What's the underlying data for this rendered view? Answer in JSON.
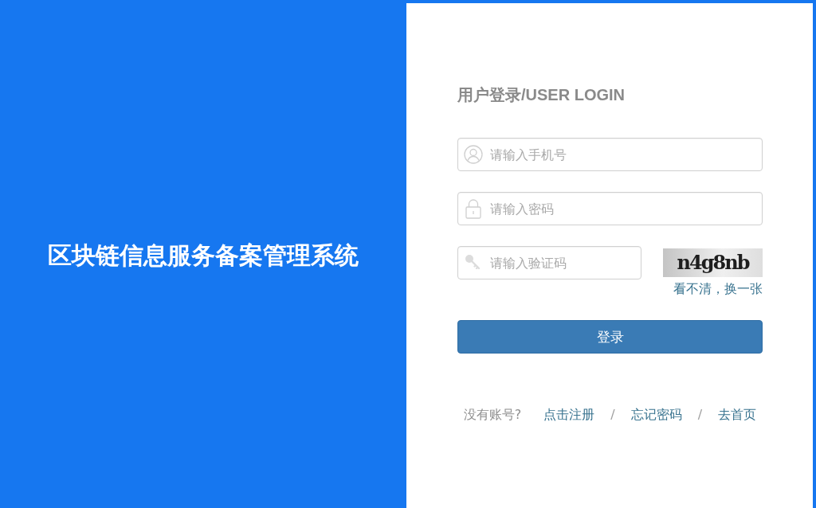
{
  "brand_panel": {
    "title": "区块链信息服务备案管理系统"
  },
  "login_form": {
    "heading": "用户登录/USER LOGIN",
    "fields": [
      {
        "kind": "phone",
        "placeholder": "请输入手机号"
      },
      {
        "kind": "password",
        "placeholder": "请输入密码"
      },
      {
        "kind": "captcha",
        "placeholder": "请输入验证码"
      }
    ],
    "captcha": {
      "code": "n4g8nb",
      "refresh_link": "看不清，换一张"
    },
    "submit_button": "登录",
    "footer": [
      {
        "kind": "text",
        "text": "没有账号?"
      },
      {
        "kind": "link",
        "text": "点击注册"
      },
      {
        "kind": "separator",
        "text": "/"
      },
      {
        "kind": "link",
        "text": "忘记密码"
      },
      {
        "kind": "separator",
        "text": "/"
      },
      {
        "kind": "link",
        "text": "去首页"
      }
    ]
  }
}
